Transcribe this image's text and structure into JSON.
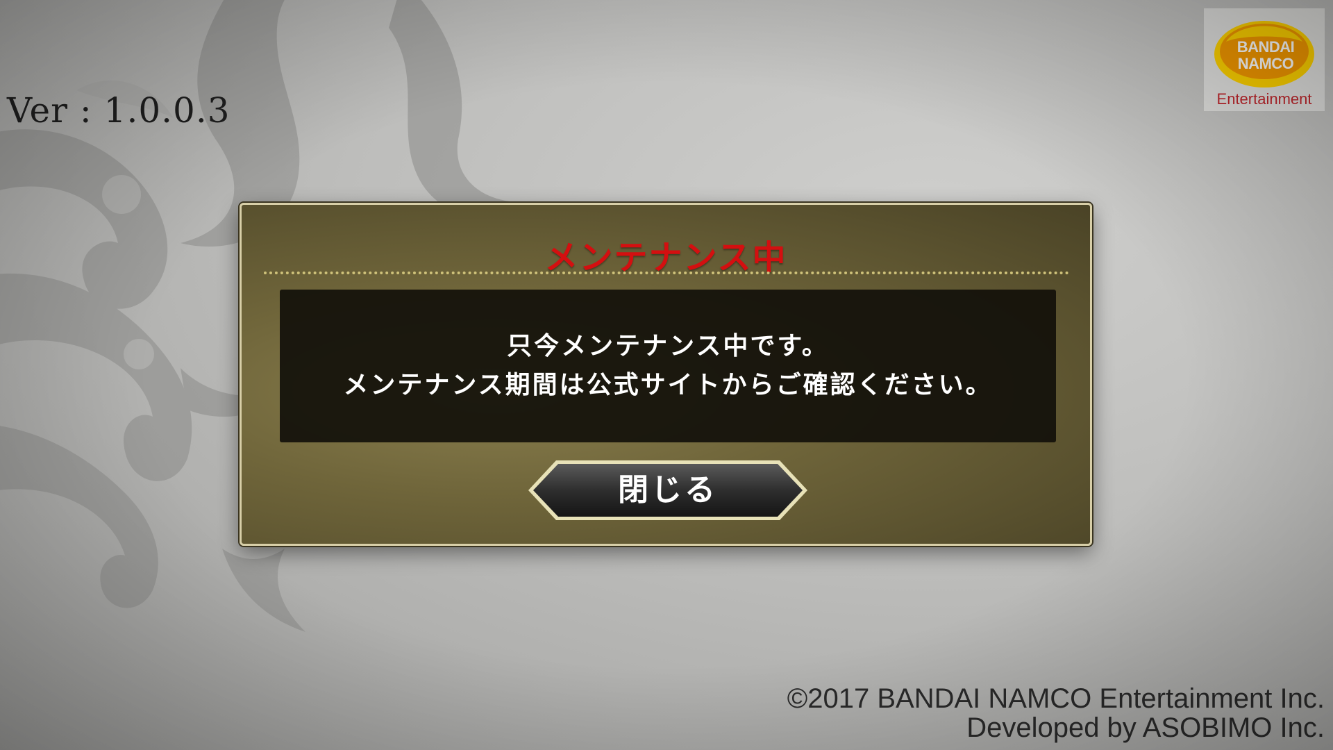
{
  "version_text": "Ver : 1.0.0.3",
  "logo": {
    "line1": "BANDAI",
    "line2": "NAMCO",
    "sub": "Entertainment",
    "orange": "#f39800",
    "yellow": "#ffd200",
    "red": "#c0272d"
  },
  "dialog": {
    "title": "メンテナンス中",
    "message_line1": "只今メンテナンス中です。",
    "message_line2": "メンテナンス期間は公式サイトからご確認ください。",
    "close_label": "閉じる",
    "title_color": "#d40f10",
    "frame_color": "#6f653a"
  },
  "footer": {
    "copyright": "©2017 BANDAI NAMCO Entertainment Inc.",
    "developer": "Developed by ASOBIMO Inc."
  },
  "icons": {
    "background": "crest-emblem-icon",
    "logo": "bandai-namco-logo-icon"
  }
}
